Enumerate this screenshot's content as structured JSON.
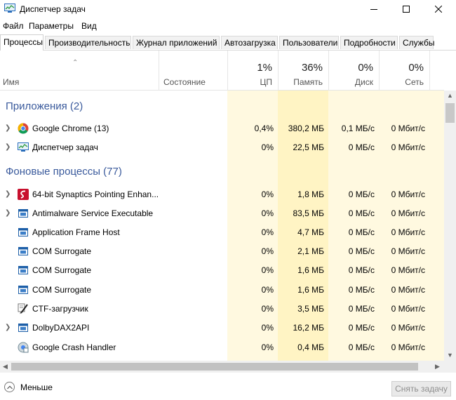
{
  "window": {
    "title": "Диспетчер задач",
    "app_icon": "task-manager-icon",
    "controls": [
      "minimize-icon",
      "maximize-icon",
      "close-icon"
    ]
  },
  "menu": [
    "Файл",
    "Параметры",
    "Вид"
  ],
  "tabs": [
    {
      "label": "Процессы",
      "active": true
    },
    {
      "label": "Производительность"
    },
    {
      "label": "Журнал приложений"
    },
    {
      "label": "Автозагрузка"
    },
    {
      "label": "Пользователи"
    },
    {
      "label": "Подробности"
    },
    {
      "label": "Службы"
    }
  ],
  "columns": {
    "name": "Имя",
    "status": "Состояние",
    "cpu": {
      "pct": "1%",
      "label": "ЦП"
    },
    "memory": {
      "pct": "36%",
      "label": "Память"
    },
    "disk": {
      "pct": "0%",
      "label": "Диск"
    },
    "network": {
      "pct": "0%",
      "label": "Сеть"
    }
  },
  "groups": {
    "apps": "Приложения (2)",
    "background": "Фоновые процессы (77)"
  },
  "apps": [
    {
      "name": "Google Chrome (13)",
      "icon": "chrome-icon",
      "cpu": "0,4%",
      "mem": "380,2 МБ",
      "disk": "0,1 МБ/с",
      "net": "0 Мбит/с"
    },
    {
      "name": "Диспетчер задач",
      "icon": "task-manager-icon",
      "cpu": "0%",
      "mem": "22,5 МБ",
      "disk": "0 МБ/с",
      "net": "0 Мбит/с"
    }
  ],
  "background": [
    {
      "name": "64-bit Synaptics Pointing Enhan...",
      "icon": "synaptics-icon",
      "expandable": true,
      "cpu": "0%",
      "mem": "1,8 МБ",
      "disk": "0 МБ/с",
      "net": "0 Мбит/с"
    },
    {
      "name": "Antimalware Service Executable",
      "icon": "service-window-icon",
      "expandable": true,
      "cpu": "0%",
      "mem": "83,5 МБ",
      "disk": "0 МБ/с",
      "net": "0 Мбит/с"
    },
    {
      "name": "Application Frame Host",
      "icon": "window-icon",
      "expandable": false,
      "cpu": "0%",
      "mem": "4,7 МБ",
      "disk": "0 МБ/с",
      "net": "0 Мбит/с"
    },
    {
      "name": "COM Surrogate",
      "icon": "window-icon",
      "expandable": false,
      "cpu": "0%",
      "mem": "2,1 МБ",
      "disk": "0 МБ/с",
      "net": "0 Мбит/с"
    },
    {
      "name": "COM Surrogate",
      "icon": "window-icon",
      "expandable": false,
      "cpu": "0%",
      "mem": "1,6 МБ",
      "disk": "0 МБ/с",
      "net": "0 Мбит/с"
    },
    {
      "name": "COM Surrogate",
      "icon": "window-icon",
      "expandable": false,
      "cpu": "0%",
      "mem": "1,6 МБ",
      "disk": "0 МБ/с",
      "net": "0 Мбит/с"
    },
    {
      "name": "CTF-загрузчик",
      "icon": "pen-icon",
      "expandable": false,
      "cpu": "0%",
      "mem": "3,5 МБ",
      "disk": "0 МБ/с",
      "net": "0 Мбит/с"
    },
    {
      "name": "DolbyDAX2API",
      "icon": "window-icon",
      "expandable": true,
      "cpu": "0%",
      "mem": "16,2 МБ",
      "disk": "0 МБ/с",
      "net": "0 Мбит/с"
    },
    {
      "name": "Google Crash Handler",
      "icon": "crash-handler-icon",
      "expandable": false,
      "cpu": "0%",
      "mem": "0,4 МБ",
      "disk": "0 МБ/с",
      "net": "0 Мбит/с"
    }
  ],
  "footer": {
    "less_label": "Меньше",
    "end_task_label": "Снять задачу"
  },
  "colors": {
    "group_title": "#3a5a9c",
    "cpu_column_bg": "#fff9e0",
    "memory_column_bg": "#fff4c4"
  }
}
